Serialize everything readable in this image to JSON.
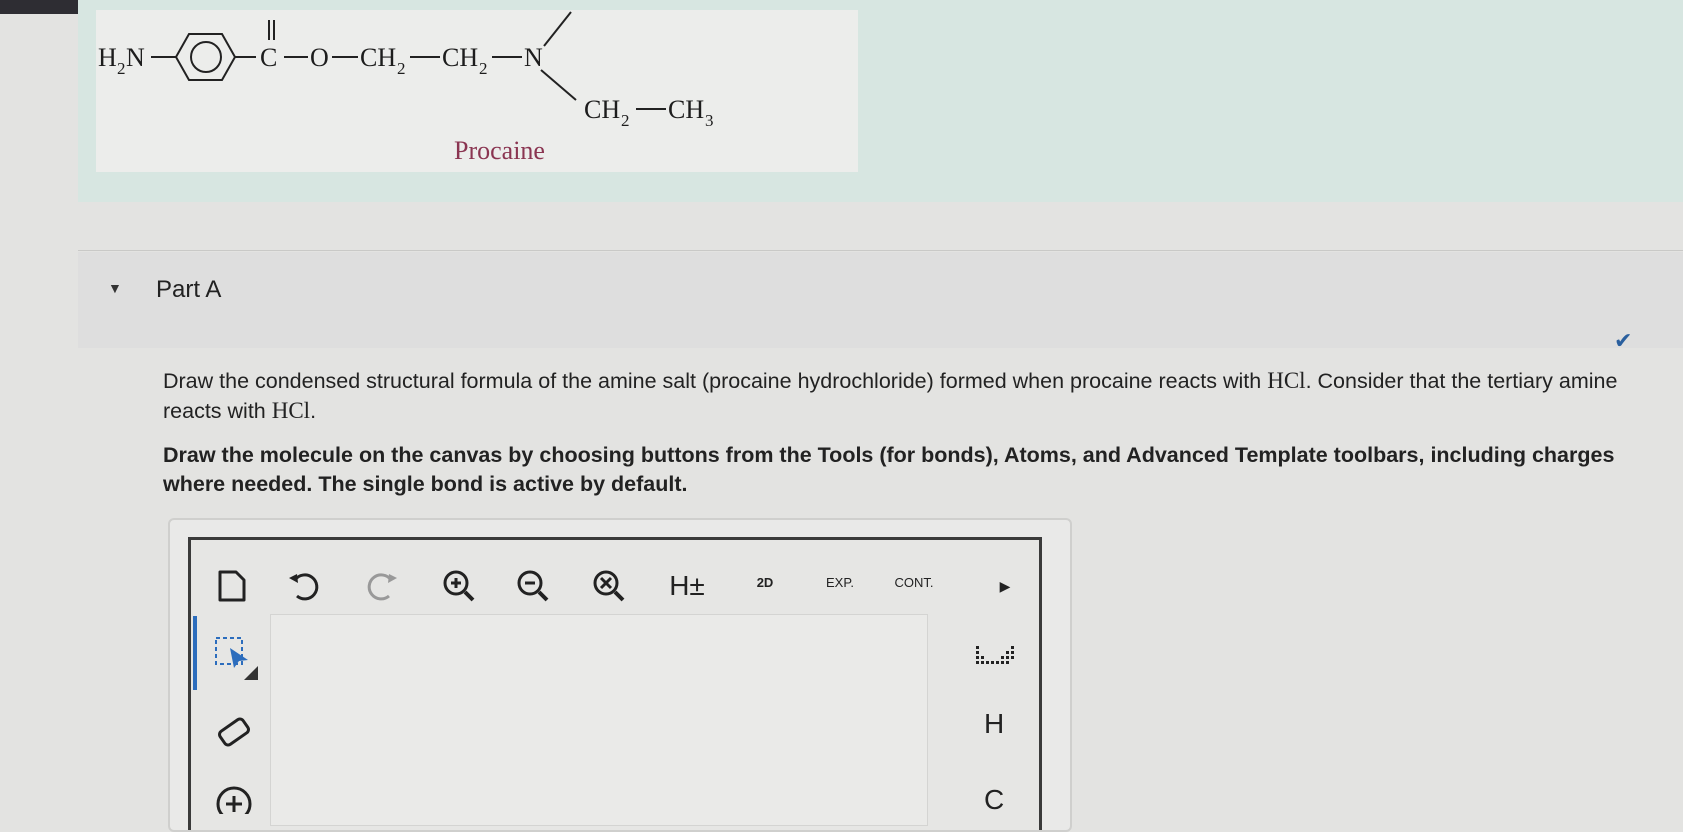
{
  "molecule": {
    "h2n": "H",
    "h2n_sub": "2",
    "h2n_n": "N",
    "carbonyl_c": "C",
    "ester_o": "O",
    "ch2": "CH",
    "sub2": "2",
    "amine_n": "N",
    "ch3": "CH",
    "sub3": "3",
    "caption": "Procaine"
  },
  "part": {
    "title": "Part A"
  },
  "question": {
    "text_before": "Draw the condensed structural formula of the amine salt (procaine hydrochloride) formed when procaine reacts with ",
    "hcl": "HCl",
    "text_middle": ". Consider that the tertiary amine reacts with ",
    "text_end": "."
  },
  "instruction": "Draw the molecule on the canvas by choosing buttons from the Tools (for bonds), Atoms, and Advanced Template toolbars, including charges where needed. The single bond is active by default.",
  "toolbar": {
    "h_label": "H±",
    "twod_label": "2D",
    "exp_label": "EXP.",
    "cont_label": "CONT."
  },
  "atoms": {
    "h": "H",
    "c": "C"
  },
  "colors": {
    "selected_tool": "#2c6dbd",
    "caption": "#8a3551",
    "check": "#2a5f9e"
  }
}
